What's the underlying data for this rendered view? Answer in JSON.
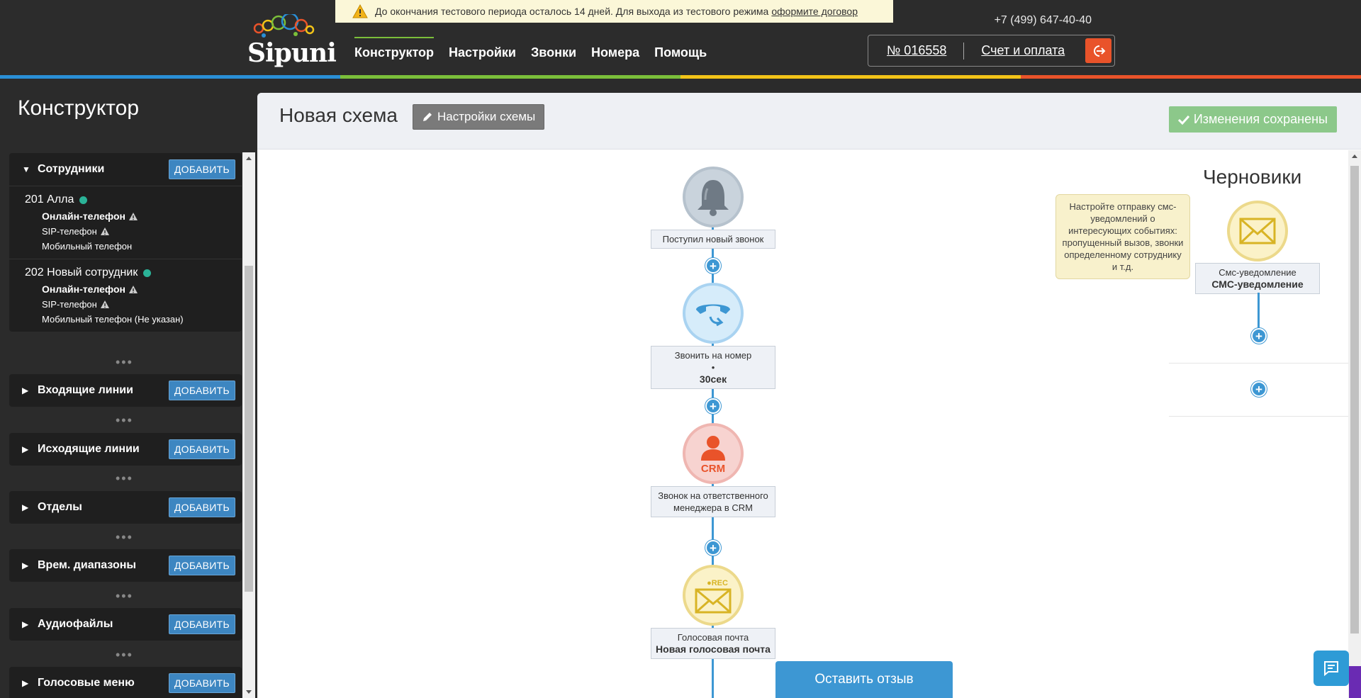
{
  "header": {
    "logo_text": "Sipuni",
    "trial_message": "До окончания тестового периода осталось 14 дней. Для выхода из тестового режима",
    "trial_link": "оформите договор",
    "phone": "+7 (499) 647-40-40",
    "nav": [
      {
        "label": "Конструктор",
        "active": true
      },
      {
        "label": "Настройки",
        "active": false
      },
      {
        "label": "Звонки",
        "active": false
      },
      {
        "label": "Номера",
        "active": false
      },
      {
        "label": "Помощь",
        "active": false
      }
    ],
    "account_number": "№ 016558",
    "billing": "Счет и оплата",
    "stripe_colors": [
      "#2a8fd6",
      "#7bbf3a",
      "#f2c318",
      "#e9532a"
    ]
  },
  "sidebar": {
    "title": "Конструктор",
    "add_label": "ДОБАВИТЬ",
    "employees_section": "Сотрудники",
    "employees": [
      {
        "name": "201 Алла",
        "online_phone": "Онлайн-телефон",
        "sip_phone": "SIP-телефон",
        "mobile_phone": "Мобильный телефон"
      },
      {
        "name": "202 Новый сотрудник",
        "online_phone": "Онлайн-телефон",
        "sip_phone": "SIP-телефон",
        "mobile_phone": "Мобильный телефон (Не указан)"
      }
    ],
    "sections": [
      "Входящие линии",
      "Исходящие линии",
      "Отделы",
      "Врем. диапазоны",
      "Аудиофайлы",
      "Голосовые меню"
    ]
  },
  "main": {
    "scheme_title": "Новая схема",
    "scheme_settings": "Настройки схемы",
    "saved_status": "Изменения сохранены",
    "nodes": {
      "incoming": "Поступил новый звонок",
      "call_number_title": "Звонить на номер",
      "call_number_bullet": "•",
      "call_number_time": "30сек",
      "crm": "Звонок на ответственного менеджера в CRM",
      "crm_icon_text": "CRM",
      "voicemail_title": "Голосовая почта",
      "voicemail_name": "Новая голосовая почта",
      "voicemail_icon_text": "●REC"
    },
    "drafts": {
      "title": "Черновики",
      "tooltip": "Настройте отправку смс-уведомлений о интересующих событиях: пропущенный вызов, звонки определенному сотруднику и т.д.",
      "sms_title": "Смс-уведомление",
      "sms_name": "СМС-уведомление"
    }
  },
  "feedback": "Оставить отзыв",
  "colors": {
    "accent_blue": "#3d97d3",
    "add_button": "#3d86c1",
    "saved_green": "#8cc88a",
    "logout_orange": "#e9532a",
    "status_online": "#2bb398"
  }
}
